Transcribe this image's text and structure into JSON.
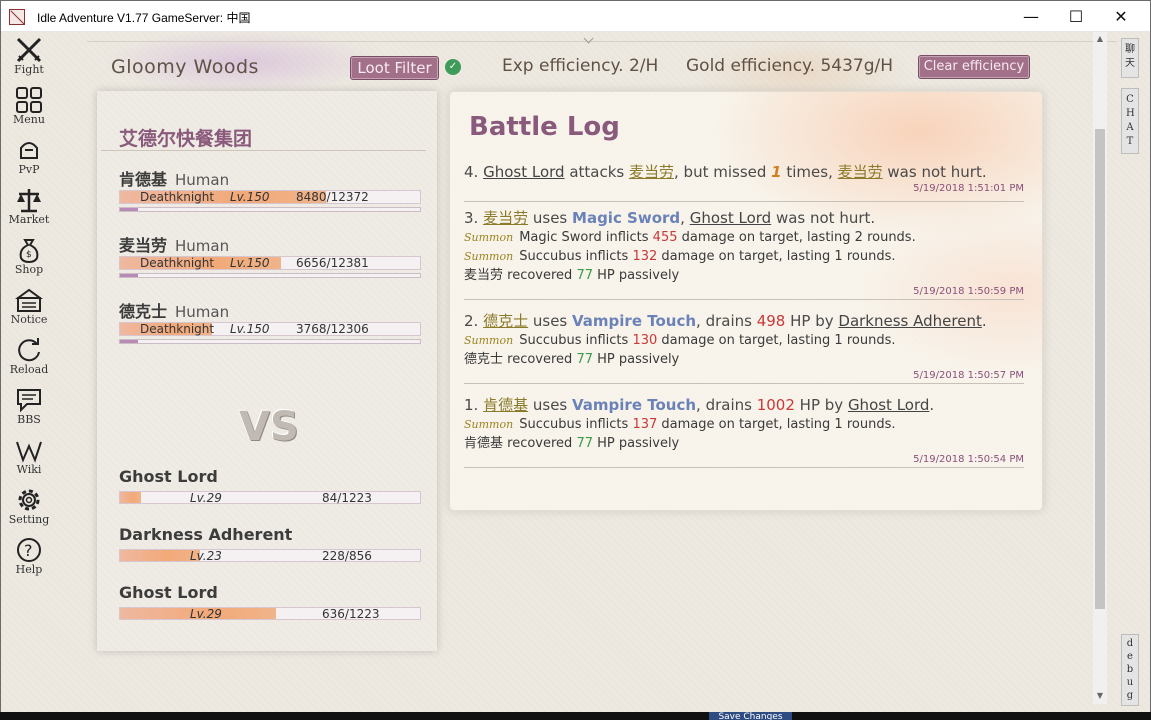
{
  "window": {
    "title": "Idle Adventure V1.77 GameServer: 中国",
    "minimize": "—",
    "maximize": "☐",
    "close": "✕"
  },
  "nav": [
    {
      "label": "Fight",
      "icon": "swords-icon"
    },
    {
      "label": "Menu",
      "icon": "grid-icon"
    },
    {
      "label": "PvP",
      "icon": "helmet-icon"
    },
    {
      "label": "Market",
      "icon": "scales-icon"
    },
    {
      "label": "Shop",
      "icon": "money-bag-icon"
    },
    {
      "label": "Notice",
      "icon": "notice-icon"
    },
    {
      "label": "Reload",
      "icon": "reload-icon"
    },
    {
      "label": "BBS",
      "icon": "chat-bubble-icon"
    },
    {
      "label": "Wiki",
      "icon": "wiki-icon"
    },
    {
      "label": "Setting",
      "icon": "gear-icon"
    },
    {
      "label": "Help",
      "icon": "help-icon"
    }
  ],
  "header": {
    "location": "Gloomy Woods",
    "loot_filter": "Loot Filter",
    "check": "✓",
    "exp_eff": "Exp efficiency. 2/H",
    "gold_eff": "Gold efficiency. 5437g/H",
    "clear_eff": "Clear efficiency"
  },
  "party": {
    "guild": "艾德尔快餐集团",
    "members": [
      {
        "name": "肯德基",
        "race": "Human",
        "cls": "Deathknight",
        "lv": "Lv.150",
        "hp": "8480/12372",
        "hp_frac": 0.685,
        "mp_frac": 0.06
      },
      {
        "name": "麦当劳",
        "race": "Human",
        "cls": "Deathknight",
        "lv": "Lv.150",
        "hp": "6656/12381",
        "hp_frac": 0.538,
        "mp_frac": 0.06
      },
      {
        "name": "德克士",
        "race": "Human",
        "cls": "Deathknight",
        "lv": "Lv.150",
        "hp": "3768/12306",
        "hp_frac": 0.306,
        "mp_frac": 0.06
      }
    ]
  },
  "vs": "VS",
  "enemies": [
    {
      "name": "Ghost Lord",
      "lv": "Lv.29",
      "hp": "84/1223",
      "hp_frac": 0.069
    },
    {
      "name": "Darkness Adherent",
      "lv": "Lv.23",
      "hp": "228/856",
      "hp_frac": 0.266
    },
    {
      "name": "Ghost Lord",
      "lv": "Lv.29",
      "hp": "636/1223",
      "hp_frac": 0.52
    }
  ],
  "log": {
    "title": "Battle Log",
    "e4": {
      "n": "4.",
      "actor": "Ghost Lord",
      "t1": " attacks ",
      "target": "麦当劳",
      "t2": ", but missed ",
      "count": "1",
      "t3": " times, ",
      "target2": "麦当劳",
      "t4": " was not hurt.",
      "ts": "5/19/2018 1:51:01 PM"
    },
    "e3": {
      "n": "3.",
      "actor": "麦当劳",
      "t1": " uses ",
      "skill": "Magic Sword",
      "t2": ", ",
      "target": "Ghost Lord",
      "t3": " was not hurt.",
      "s1_tag": "Summon",
      "s1_a": "Magic Sword inflicts ",
      "s1_n": "455",
      "s1_b": " damage on target, lasting 2 rounds.",
      "s2_tag": "Summon",
      "s2_a": "Succubus inflicts ",
      "s2_n": "132",
      "s2_b": " damage on target, lasting 1 rounds.",
      "r_name": "麦当劳",
      "r_a": " recovered ",
      "r_n": "77",
      "r_b": " HP passively",
      "ts": "5/19/2018 1:50:59 PM"
    },
    "e2": {
      "n": "2.",
      "actor": "德克士",
      "t1": " uses ",
      "skill": "Vampire Touch",
      "t2": ", drains ",
      "amt": "498",
      "t3": " HP by ",
      "target": "Darkness Adherent",
      "t4": ".",
      "s1_tag": "Summon",
      "s1_a": "Succubus inflicts ",
      "s1_n": "130",
      "s1_b": " damage on target, lasting 1 rounds.",
      "r_name": "德克士",
      "r_a": " recovered ",
      "r_n": "77",
      "r_b": " HP passively",
      "ts": "5/19/2018 1:50:57 PM"
    },
    "e1": {
      "n": "1.",
      "actor": "肯德基",
      "t1": " uses ",
      "skill": "Vampire Touch",
      "t2": ", drains ",
      "amt": "1002",
      "t3": " HP by ",
      "target": "Ghost Lord",
      "t4": ".",
      "s1_tag": "Summon",
      "s1_a": "Succubus inflicts ",
      "s1_n": "137",
      "s1_b": " damage on target, lasting 1 rounds.",
      "r_name": "肯德基",
      "r_a": " recovered ",
      "r_n": "77",
      "r_b": " HP passively",
      "ts": "5/19/2018 1:50:54 PM"
    }
  },
  "side_tabs": {
    "chat_cn": "聊天",
    "chat": "CHAT",
    "debug": "debug"
  },
  "scroll": {
    "up": "▲",
    "down": "▼"
  },
  "save": "Save Changes"
}
